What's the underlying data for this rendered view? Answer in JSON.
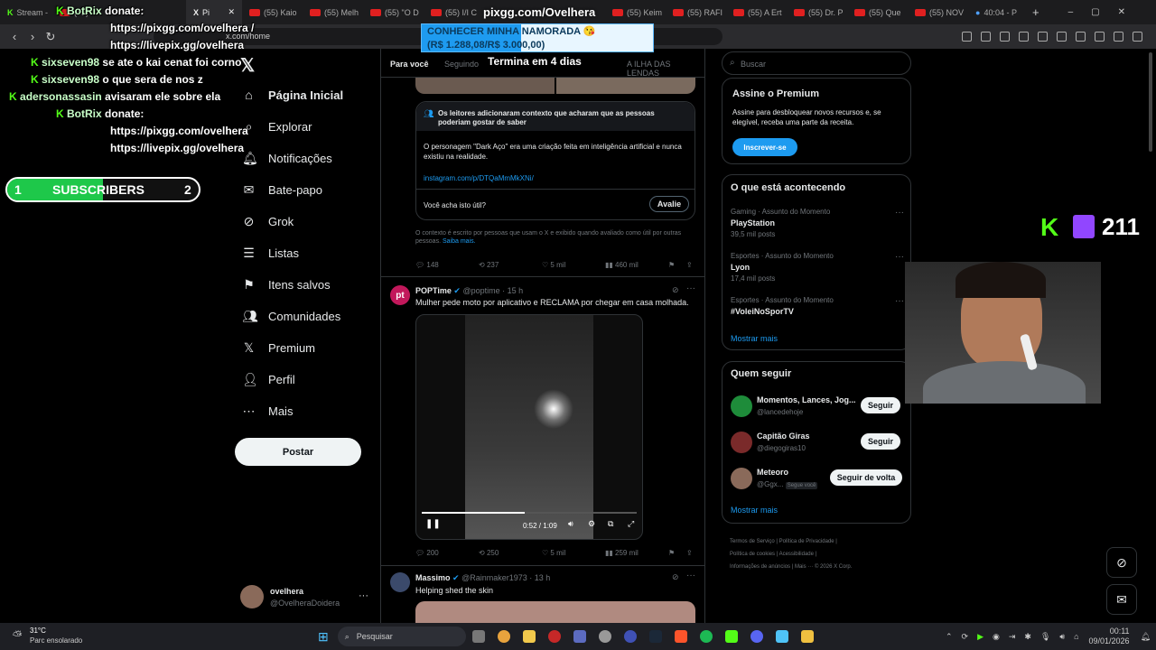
{
  "tabs": [
    {
      "label": "Stream -"
    },
    {
      "label": "(55)"
    },
    {
      "label": "Pi",
      "active": true
    },
    {
      "label": "(55) Kaio"
    },
    {
      "label": "(55) Melh"
    },
    {
      "label": "(55) \"O D"
    },
    {
      "label": "(55) I/I C"
    },
    {
      "label": "(55) Keim"
    },
    {
      "label": "(55) RAFI"
    },
    {
      "label": "(55) A Ert"
    },
    {
      "label": "(55) Dr. P"
    },
    {
      "label": "(55) Que"
    },
    {
      "label": "(55) NOV"
    },
    {
      "label": "40:04 - P"
    }
  ],
  "address": {
    "url": "x.com/home"
  },
  "x": {
    "nav": [
      "Página Inicial",
      "Explorar",
      "Notificações",
      "Bate-papo",
      "Grok",
      "Listas",
      "Itens salvos",
      "Comunidades",
      "Premium",
      "Perfil",
      "Mais"
    ],
    "post_label": "Postar",
    "account": {
      "name": "ovelhera",
      "handle": "@OvelheraDoidera"
    },
    "feed_tabs": [
      "Para você",
      "Seguindo",
      "A ILHA DAS LENDAS"
    ],
    "note": {
      "header": "Os leitores adicionaram contexto que acharam que as pessoas poderiam gostar de saber",
      "body": "O personagem \"Dark Aço\" era uma criação feita em inteligência artificial e nunca existiu na realidade.",
      "link": "instagram.com/p/DTQaMmMkXNi/",
      "question": "Você acha isto útil?",
      "rate": "Avalie",
      "footer": "O contexto é escrito por pessoas que usam o X e exibido quando avaliado como útil por outras pessoas.",
      "more": "Saiba mais."
    },
    "stats1": {
      "replies": "148",
      "reposts": "237",
      "likes": "5 mil",
      "views": "460 mil"
    },
    "post2": {
      "name": "POPTime",
      "handle": "@poptime · 15 h",
      "text": "Mulher pede moto por aplicativo e RECLAMA por chegar em casa molhada.",
      "time": "0:52 / 1:09",
      "avatar": "pt"
    },
    "stats2": {
      "replies": "200",
      "reposts": "250",
      "likes": "5 mil",
      "views": "259 mil"
    },
    "post3": {
      "name": "Massimo",
      "handle": "@Rainmaker1973 · 13 h",
      "text": "Helping shed the skin"
    },
    "search_placeholder": "Buscar",
    "premium": {
      "title": "Assine o Premium",
      "body": "Assine para desbloquear novos recursos e, se elegível, receba uma parte da receita.",
      "button": "Inscrever-se"
    },
    "trends": {
      "title": "O que está acontecendo",
      "items": [
        {
          "meta": "Gaming · Assunto do Momento",
          "name": "PlayStation",
          "count": "39,5 mil posts"
        },
        {
          "meta": "Esportes · Assunto do Momento",
          "name": "Lyon",
          "count": "17,4 mil posts"
        },
        {
          "meta": "Esportes · Assunto do Momento",
          "name": "#VoleiNoSporTV",
          "count": ""
        }
      ],
      "more": "Mostrar mais"
    },
    "follow": {
      "title": "Quem seguir",
      "items": [
        {
          "name": "Momentos, Lances, Jog...",
          "handle": "@lancedehoje",
          "button": "Seguir"
        },
        {
          "name": "Capitão Giras",
          "handle": "@diegogiras10",
          "button": "Seguir"
        },
        {
          "name": "Meteoro",
          "handle": "@Ggx...",
          "badge": "Segue você",
          "button": "Seguir de volta"
        }
      ],
      "more": "Mostrar mais"
    },
    "footer": [
      "Termos de Serviço",
      "Política de Privacidade",
      "Política de cookies",
      "Acessibilidade",
      "Informações de anúncios",
      "Mais ···",
      "© 2026 X Corp."
    ]
  },
  "overlay": {
    "chat": [
      {
        "user": "BotRix",
        "msg": "donate:"
      },
      {
        "user": "",
        "msg": "https://pixgg.com/ovelhera /"
      },
      {
        "user": "",
        "msg": "https://livepix.gg/ovelhera"
      },
      {
        "user": "sixseven98",
        "msg": "se ate o kai cenat foi corno"
      },
      {
        "user": "sixseven98",
        "msg": "o que sera de nos z"
      },
      {
        "user": "adersonassasin",
        "msg": "avisaram ele sobre ela"
      },
      {
        "user": "BotRix",
        "msg": "donate:"
      },
      {
        "user": "",
        "msg": "https://pixgg.com/ovelhera"
      },
      {
        "user": "",
        "msg": "https://livepix.gg/ovelhera"
      }
    ],
    "subs": {
      "left": "1",
      "label": "SUBSCRIBERS",
      "right": "2",
      "progress": 0.5
    },
    "pix_title": "pixgg.com/Ovelhera",
    "goal": {
      "title": "CONHECER MINHA NAMORADA 😘",
      "amount": "(R$ 1.288,08/R$ 3.000,00)",
      "progress": 0.43,
      "timer": "Termina em 4 dias"
    },
    "viewers": "211"
  },
  "taskbar": {
    "weather_temp": "31°C",
    "weather_desc": "Parc ensolarado",
    "search": "Pesquisar",
    "time": "00:11",
    "date": "09/01/2026"
  }
}
